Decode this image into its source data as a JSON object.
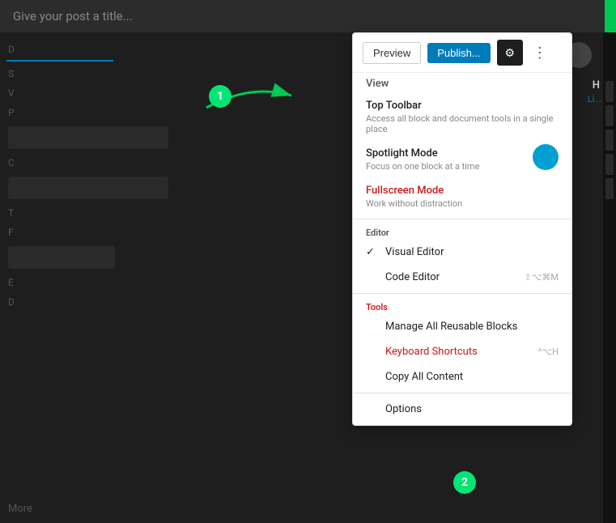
{
  "topbar": {
    "title": "Give your post a title...",
    "preview_label": "Preview",
    "publish_label": "Publish...",
    "gear_icon": "⚙",
    "more_icon": "⋮"
  },
  "dropdown": {
    "view_label": "View",
    "top_toolbar": {
      "title": "Top Toolbar",
      "desc": "Access all block and document tools in a single place"
    },
    "spotlight_mode": {
      "title": "Spotlight Mode",
      "desc": "Focus on one block at a time"
    },
    "fullscreen_mode": {
      "title": "Fullscreen Mode",
      "desc": "Work without distraction"
    },
    "editor_label": "Editor",
    "visual_editor": {
      "label": "Visual Editor",
      "check": "✓"
    },
    "code_editor": {
      "label": "Code Editor",
      "shortcut": "⇧⌥⌘M"
    },
    "tools_label": "Tools",
    "manage_blocks": {
      "label": "Manage All Reusable Blocks"
    },
    "keyboard_shortcuts": {
      "label": "Keyboard Shortcuts",
      "shortcut": "^⌥H"
    },
    "copy_content": {
      "label": "Copy All Content"
    },
    "options": {
      "label": "Options"
    }
  },
  "badges": {
    "badge1": "1",
    "badge2": "2"
  },
  "sidebar": {
    "items": [
      "D",
      "S",
      "V",
      "P",
      "C",
      "T",
      "F",
      "E",
      "D"
    ]
  },
  "right_panel": {
    "h_label": "H",
    "h_sub": "Li..."
  },
  "bottom": {
    "more": "More"
  }
}
